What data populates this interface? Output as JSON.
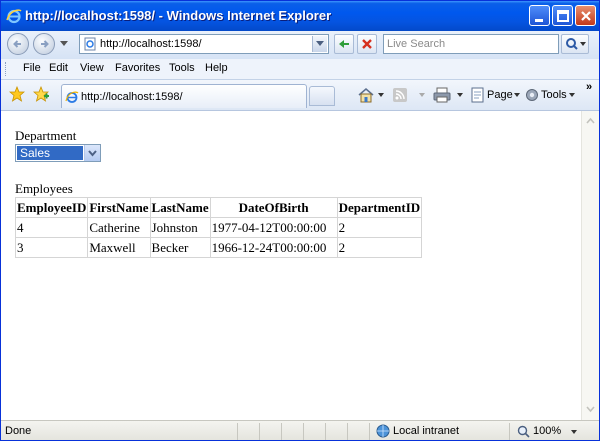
{
  "window": {
    "title": "http://localhost:1598/ - Windows Internet Explorer"
  },
  "address_bar": {
    "url": "http://localhost:1598/",
    "search_placeholder": "Live Search"
  },
  "menu": {
    "items": [
      "File",
      "Edit",
      "View",
      "Favorites",
      "Tools",
      "Help"
    ]
  },
  "tab": {
    "title": "http://localhost:1598/"
  },
  "command_bar": {
    "page_label": "Page",
    "tools_label": "Tools"
  },
  "page": {
    "department_label": "Department",
    "department_selected": "Sales",
    "employees_label": "Employees",
    "table": {
      "headers": [
        "EmployeeID",
        "FirstName",
        "LastName",
        "DateOfBirth",
        "DepartmentID"
      ],
      "rows": [
        [
          "4",
          "Catherine",
          "Johnston",
          "1977-04-12T00:00:00",
          "2"
        ],
        [
          "3",
          "Maxwell",
          "Becker",
          "1966-12-24T00:00:00",
          "2"
        ]
      ]
    }
  },
  "status_bar": {
    "status": "Done",
    "zone": "Local intranet",
    "zoom": "100%"
  },
  "colors": {
    "titlebar": "#0058ee",
    "selection": "#316ac5"
  }
}
